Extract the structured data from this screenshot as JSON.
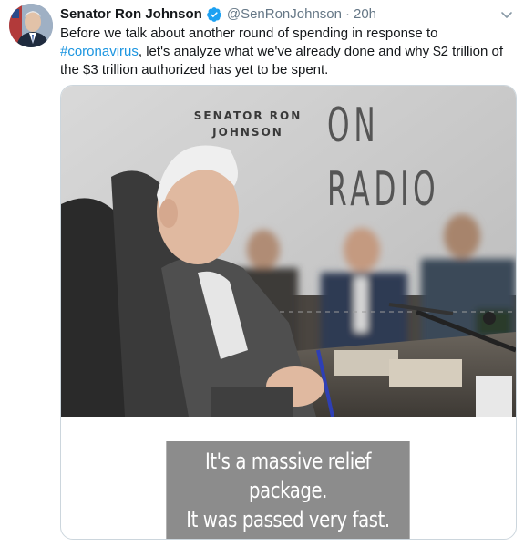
{
  "tweet": {
    "author_name": "Senator Ron Johnson",
    "handle": "@SenRonJohnson",
    "separator": "·",
    "time": "20h",
    "text_before": "Before we talk about another round of spending in response to ",
    "hashtag": "#coronavirus",
    "text_after": ", let's analyze what we've already done and why $2 trillion of the $3 trillion authorized has yet to be spent."
  },
  "media": {
    "promo_line1": "SENATOR RON",
    "promo_line2": "JOHNSON",
    "promo_word1": "ON",
    "promo_word2": "RADIO",
    "caption_line1": "It's a massive relief package.",
    "caption_line2": "It was passed very fast."
  },
  "colors": {
    "link": "#1b95e0",
    "verified": "#1da1f2",
    "muted": "#657786"
  },
  "icons": {
    "verified": "verified-badge-icon",
    "more": "chevron-down-icon"
  }
}
